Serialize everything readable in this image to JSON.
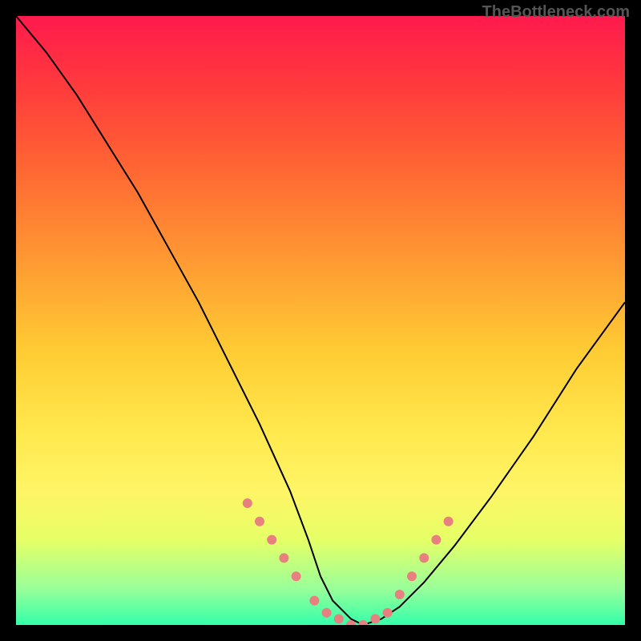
{
  "watermark": "TheBottleneck.com",
  "chart_data": {
    "type": "line",
    "title": "",
    "xlabel": "",
    "ylabel": "",
    "xlim": [
      0,
      100
    ],
    "ylim": [
      0,
      100
    ],
    "grid": false,
    "series": [
      {
        "name": "bottleneck-curve",
        "x": [
          0,
          5,
          10,
          15,
          20,
          25,
          30,
          35,
          40,
          45,
          48,
          50,
          52,
          55,
          57,
          60,
          63,
          67,
          72,
          78,
          85,
          92,
          100
        ],
        "y": [
          100,
          94,
          87,
          79,
          71,
          62,
          53,
          43,
          33,
          22,
          14,
          8,
          4,
          1,
          0,
          1,
          3,
          7,
          13,
          21,
          31,
          42,
          53
        ],
        "color": "#000000"
      }
    ],
    "highlight_points": {
      "name": "marked-region",
      "color": "#e88080",
      "points": [
        {
          "x": 38,
          "y": 20
        },
        {
          "x": 40,
          "y": 17
        },
        {
          "x": 42,
          "y": 14
        },
        {
          "x": 44,
          "y": 11
        },
        {
          "x": 46,
          "y": 8
        },
        {
          "x": 49,
          "y": 4
        },
        {
          "x": 51,
          "y": 2
        },
        {
          "x": 53,
          "y": 1
        },
        {
          "x": 55,
          "y": 0
        },
        {
          "x": 57,
          "y": 0
        },
        {
          "x": 59,
          "y": 1
        },
        {
          "x": 61,
          "y": 2
        },
        {
          "x": 63,
          "y": 5
        },
        {
          "x": 65,
          "y": 8
        },
        {
          "x": 67,
          "y": 11
        },
        {
          "x": 69,
          "y": 14
        },
        {
          "x": 71,
          "y": 17
        }
      ]
    }
  }
}
